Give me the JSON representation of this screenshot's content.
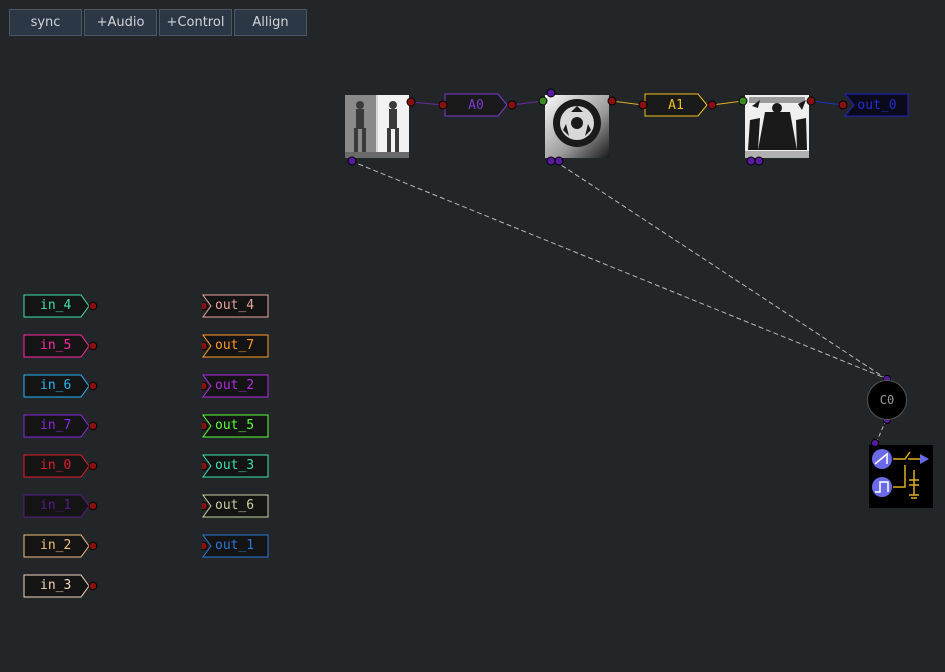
{
  "toolbar": {
    "sync": "sync",
    "audio": "+Audio",
    "control": "+Control",
    "allign": "Allign"
  },
  "nodes": {
    "a0": "A0",
    "a1": "A1",
    "c0": "C0",
    "out_main": "out_0"
  },
  "inputs": [
    {
      "label": "in_4",
      "color": "#3fe0b0"
    },
    {
      "label": "in_5",
      "color": "#ff2aa8"
    },
    {
      "label": "in_6",
      "color": "#29b6f6"
    },
    {
      "label": "in_7",
      "color": "#8a2be2"
    },
    {
      "label": "in_0",
      "color": "#e0202a"
    },
    {
      "label": "in_1",
      "color": "#5a1a8a"
    },
    {
      "label": "in_2",
      "color": "#f0c080"
    },
    {
      "label": "in_3",
      "color": "#f3d7b8"
    }
  ],
  "outputs": [
    {
      "label": "out_4",
      "color": "#e9a49a"
    },
    {
      "label": "out_7",
      "color": "#ff9a2a"
    },
    {
      "label": "out_2",
      "color": "#b42be2"
    },
    {
      "label": "out_5",
      "color": "#5bff3a"
    },
    {
      "label": "out_3",
      "color": "#3fe0b0"
    },
    {
      "label": "out_6",
      "color": "#c8d0a0"
    },
    {
      "label": "out_1",
      "color": "#2a7ad8"
    }
  ],
  "colors": {
    "background": "#232629",
    "a0": "#7a3ad0",
    "a1": "#f0c020",
    "out_main": "#2020c0",
    "port": "#8a1010",
    "port_purple": "#5a1aa0",
    "port_green": "#3a8a20",
    "wire_dashed": "#b8b8b8"
  }
}
